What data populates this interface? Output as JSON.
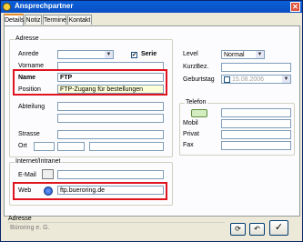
{
  "window": {
    "title": "Ansprechpartner"
  },
  "tabs": [
    "Details",
    "Notiz",
    "Termine",
    "Kontakt"
  ],
  "adresse": {
    "group_title": "Adresse",
    "anrede_label": "Anrede",
    "anrede_value": "",
    "serie_label": "Serie",
    "serie_checked": "✔",
    "vorname_label": "Vorname",
    "vorname_value": "",
    "name_label": "Name",
    "name_value": "FTP",
    "position_label": "Position",
    "position_value": "FTP-Zugang für bestellungen",
    "abteilung_label": "Abteilung",
    "strasse_label": "Strasse",
    "ort_label": "Ort"
  },
  "right": {
    "level_label": "Level",
    "level_value": "Normal",
    "kurzbez_label": "KurzBez.",
    "geburtstag_label": "Geburtstag",
    "geburtstag_value": "15.08.2006"
  },
  "telefon": {
    "group_title": "Telefon",
    "mobil_label": "Mobil",
    "privat_label": "Privat",
    "fax_label": "Fax"
  },
  "internet": {
    "group_title": "Internet/Intranet",
    "email_label": "E-Mail",
    "web_label": "Web",
    "web_value": "ftp.bueroring.de"
  },
  "footer": {
    "title": "Adresse",
    "company": "Büroring e. G."
  },
  "buttons": {
    "refresh": "⟳",
    "undo": "↶",
    "ok": "✓"
  }
}
